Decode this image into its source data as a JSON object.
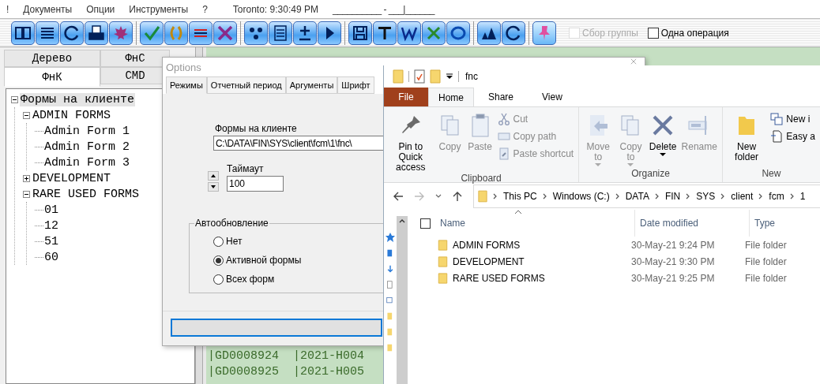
{
  "menu_bar": {
    "items": [
      {
        "label": "!"
      },
      {
        "label": "Документы"
      },
      {
        "label": "Опции"
      },
      {
        "label": "Инструменты"
      },
      {
        "label": "?"
      }
    ],
    "clock": "Toronto: 9:30:49 PM",
    "field_mask": "__________ - ___|______"
  },
  "toolbar": {
    "checkboxes": [
      {
        "label": "Сбор группы",
        "checked": false,
        "disabled": true
      },
      {
        "label": "Одна операция",
        "checked": false,
        "disabled": false
      }
    ]
  },
  "left_panel": {
    "tab_rows": [
      [
        {
          "label": "Дерево",
          "selected": false
        },
        {
          "label": "ФнС",
          "selected": false
        }
      ],
      [
        {
          "label": "ФнК",
          "selected": true
        },
        {
          "label": "CMD",
          "selected": false
        }
      ]
    ],
    "tree": [
      {
        "label": "Формы на клиенте",
        "selected": true,
        "expanded": true,
        "children": [
          {
            "label": "ADMIN FORMS",
            "selected": false,
            "expanded": true,
            "children": [
              {
                "label": "Admin Form 1",
                "selected": false
              },
              {
                "label": "Admin Form 2",
                "selected": false
              },
              {
                "label": "Admin Form 3",
                "selected": false
              }
            ]
          },
          {
            "label": "DEVELOPMENT",
            "selected": false,
            "expanded": false
          },
          {
            "label": "RARE USED FORMS",
            "selected": false,
            "expanded": true,
            "children": [
              {
                "label": "01",
                "selected": false
              },
              {
                "label": "12",
                "selected": false
              },
              {
                "label": "51",
                "selected": false
              },
              {
                "label": "60",
                "selected": false
              }
            ]
          }
        ]
      }
    ]
  },
  "data_panel": {
    "rows": [
      "|GD0008924  |2021-H004",
      "|GD0008925  |2021-H005"
    ]
  },
  "options_dialog": {
    "title": "Options",
    "tabs": [
      {
        "label": "Режимы",
        "selected": true
      },
      {
        "label": "Отчетный период",
        "selected": false
      },
      {
        "label": "Аргументы",
        "selected": false
      },
      {
        "label": "Шрифт",
        "selected": false
      }
    ],
    "forms_label": "Формы на клиенте",
    "forms_path": "C:\\DATA\\FIN\\SYS\\client\\fcm\\1\\fnc\\",
    "timeout_label": "Таймаут",
    "timeout_value": "100",
    "autorefresh": {
      "legend": "Автообновление",
      "options": [
        {
          "label": "Нет",
          "selected": false
        },
        {
          "label": "Активной формы",
          "selected": true
        },
        {
          "label": "Всех форм",
          "selected": false
        }
      ]
    }
  },
  "explorer": {
    "title": "fnc",
    "ribbon_tabs": [
      {
        "label": "File",
        "kind": "file",
        "selected": false
      },
      {
        "label": "Home",
        "kind": "tab",
        "selected": true
      },
      {
        "label": "Share",
        "kind": "tab",
        "selected": false
      },
      {
        "label": "View",
        "kind": "tab",
        "selected": false
      }
    ],
    "ribbon_groups": [
      {
        "label": "Clipboard",
        "items": [
          {
            "label": "Pin to Quick access",
            "kind": "large",
            "disabled": false,
            "dropdown": false
          },
          {
            "label": "Copy",
            "kind": "large",
            "disabled": true,
            "dropdown": false
          },
          {
            "label": "Paste",
            "kind": "large",
            "disabled": true,
            "dropdown": false
          },
          {
            "label": "Cut",
            "kind": "small",
            "disabled": true,
            "dropdown": false
          },
          {
            "label": "Copy path",
            "kind": "small",
            "disabled": true,
            "dropdown": false
          },
          {
            "label": "Paste shortcut",
            "kind": "small",
            "disabled": true,
            "dropdown": false
          }
        ]
      },
      {
        "label": "Organize",
        "items": [
          {
            "label": "Move to",
            "kind": "large",
            "disabled": true,
            "dropdown": true
          },
          {
            "label": "Copy to",
            "kind": "large",
            "disabled": true,
            "dropdown": true
          },
          {
            "label": "Delete",
            "kind": "large",
            "disabled": false,
            "dropdown": true
          },
          {
            "label": "Rename",
            "kind": "large",
            "disabled": true,
            "dropdown": false
          }
        ]
      },
      {
        "label": "New",
        "items": [
          {
            "label": "New folder",
            "kind": "large",
            "disabled": false,
            "dropdown": false
          },
          {
            "label": "New i",
            "kind": "small",
            "disabled": false,
            "dropdown": false
          },
          {
            "label": "Easy a",
            "kind": "small",
            "disabled": false,
            "dropdown": false
          }
        ]
      }
    ],
    "breadcrumbs": [
      "This PC",
      "Windows (C:)",
      "DATA",
      "FIN",
      "SYS",
      "client",
      "fcm",
      "1"
    ],
    "columns": [
      "Name",
      "Date modified",
      "Type"
    ],
    "select_all_checked": false,
    "rows": [
      {
        "name": "ADMIN FORMS",
        "date": "30-May-21 9:24 PM",
        "type": "File folder"
      },
      {
        "name": "DEVELOPMENT",
        "date": "30-May-21 9:30 PM",
        "type": "File folder"
      },
      {
        "name": "RARE USED FORMS",
        "date": "30-May-21 9:25 PM",
        "type": "File folder"
      }
    ]
  }
}
